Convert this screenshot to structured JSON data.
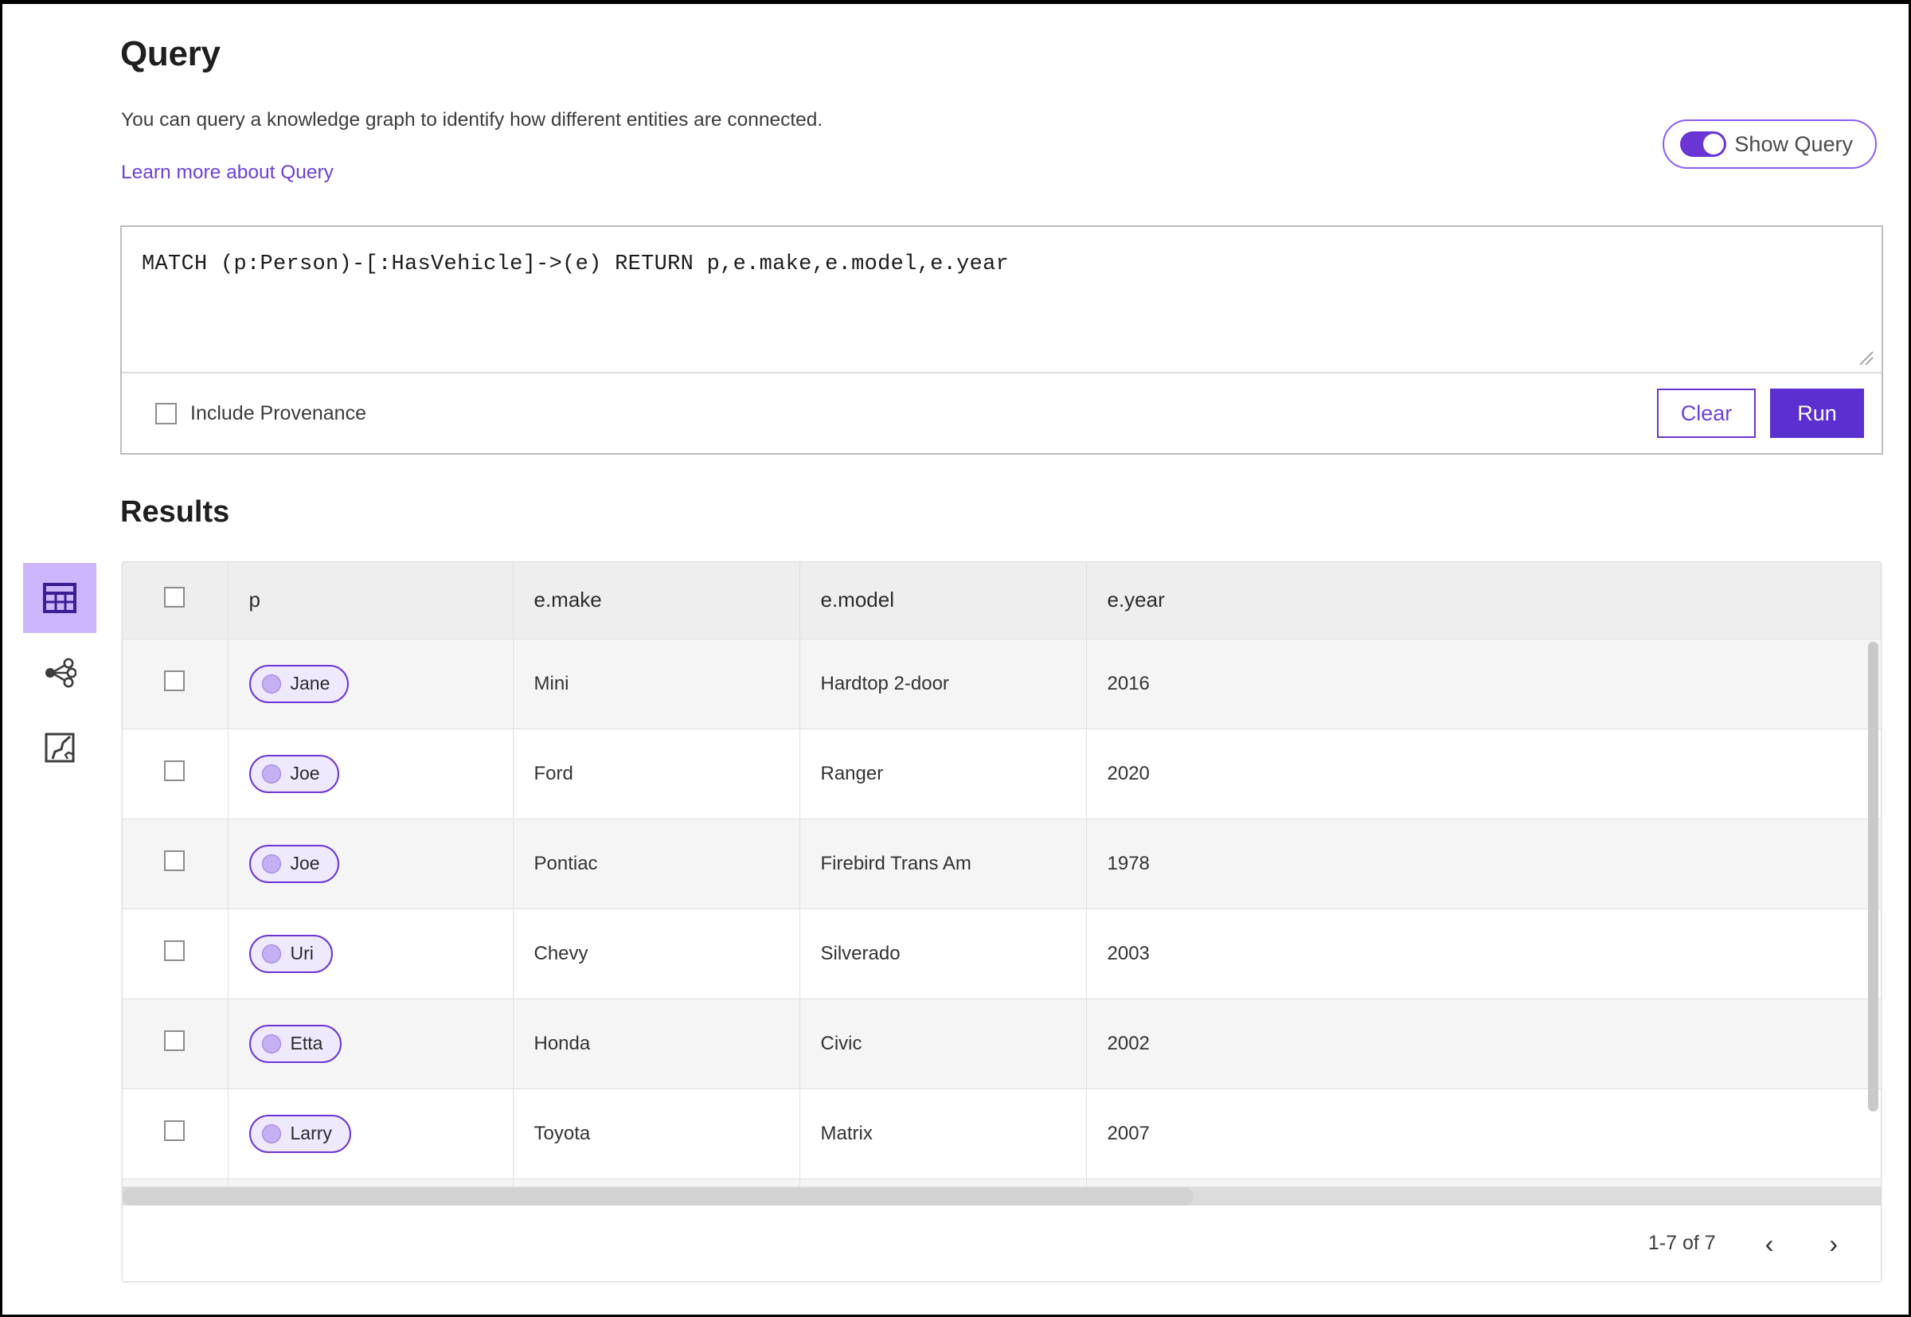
{
  "header": {
    "title": "Query",
    "subtitle": "You can query a knowledge graph to identify how different entities are connected.",
    "learn_more_link": "Learn more about Query"
  },
  "show_query_toggle": {
    "label": "Show Query",
    "enabled": true
  },
  "query_editor": {
    "text": "MATCH (p:Person)-[:HasVehicle]->(e) RETURN p,e.make,e.model,e.year",
    "include_provenance_label": "Include Provenance",
    "include_provenance_checked": false,
    "clear_label": "Clear",
    "run_label": "Run"
  },
  "sidebar": {
    "items": [
      {
        "name": "table-view",
        "icon": "table-icon",
        "active": true
      },
      {
        "name": "graph-view",
        "icon": "graph-network-icon",
        "active": false
      },
      {
        "name": "map-view",
        "icon": "map-icon",
        "active": false
      }
    ]
  },
  "results": {
    "title": "Results",
    "columns": [
      "p",
      "e.make",
      "e.model",
      "e.year"
    ],
    "rows": [
      {
        "p": "Jane",
        "make": "Mini",
        "model": "Hardtop 2-door",
        "year": "2016"
      },
      {
        "p": "Joe",
        "make": "Ford",
        "model": "Ranger",
        "year": "2020"
      },
      {
        "p": "Joe",
        "make": "Pontiac",
        "model": "Firebird Trans Am",
        "year": "1978"
      },
      {
        "p": "Uri",
        "make": "Chevy",
        "model": "Silverado",
        "year": "2003"
      },
      {
        "p": "Etta",
        "make": "Honda",
        "model": "Civic",
        "year": "2002"
      },
      {
        "p": "Larry",
        "make": "Toyota",
        "model": "Matrix",
        "year": "2007"
      },
      {
        "p": "",
        "make": "",
        "model": "",
        "year": ""
      }
    ],
    "pagination": {
      "range_label": "1-7 of 7",
      "prev_glyph": "‹",
      "next_glyph": "›"
    }
  },
  "colors": {
    "accent": "#6a35d4",
    "accent_light": "#cdb6fb",
    "chip_fill": "#efe9fd",
    "link": "#6b41d8",
    "header_bg": "#eeeeee"
  }
}
